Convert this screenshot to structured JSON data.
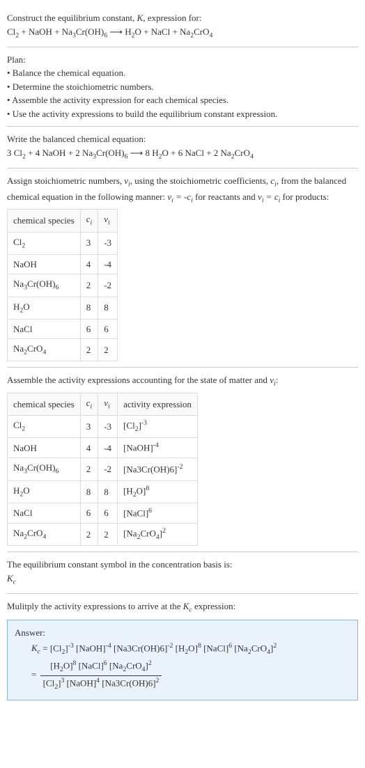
{
  "intro": {
    "line1_a": "Construct the equilibrium constant, ",
    "line1_b": ", expression for:",
    "eq_lhs": "Cl",
    "eq_plus1": " + NaOH + Na",
    "eq_croh": "Cr(OH)",
    "eq_arrow": "  ⟶  H",
    "eq_o_nacl": "O + NaCl + Na",
    "eq_cro4": "CrO"
  },
  "plan": {
    "header": "Plan:",
    "b1": "• Balance the chemical equation.",
    "b2": "• Determine the stoichiometric numbers.",
    "b3": "• Assemble the activity expression for each chemical species.",
    "b4": "• Use the activity expressions to build the equilibrium constant expression."
  },
  "balanced": {
    "header": "Write the balanced chemical equation:",
    "c1": "3 Cl",
    "c2": " + 4 NaOH + 2 Na",
    "c3": "Cr(OH)",
    "c4": "  ⟶  8 H",
    "c5": "O + 6 NaCl + 2 Na",
    "c6": "CrO"
  },
  "assign": {
    "l1a": "Assign stoichiometric numbers, ",
    "l1b": ", using the stoichiometric coefficients, ",
    "l1c": ", from the balanced chemical equation in the following manner: ",
    "l1d": " for reactants and ",
    "l1e": " for products:"
  },
  "table1": {
    "h1": "chemical species",
    "rows": [
      {
        "sp_a": "Cl",
        "sp_sub": "2",
        "sp_b": "",
        "ci": "3",
        "vi": "-3"
      },
      {
        "sp_a": "NaOH",
        "sp_sub": "",
        "sp_b": "",
        "ci": "4",
        "vi": "-4"
      },
      {
        "sp_a": "Na",
        "sp_sub": "3",
        "sp_b": "Cr(OH)",
        "sp_sub2": "6",
        "ci": "2",
        "vi": "-2"
      },
      {
        "sp_a": "H",
        "sp_sub": "2",
        "sp_b": "O",
        "ci": "8",
        "vi": "8"
      },
      {
        "sp_a": "NaCl",
        "sp_sub": "",
        "sp_b": "",
        "ci": "6",
        "vi": "6"
      },
      {
        "sp_a": "Na",
        "sp_sub": "2",
        "sp_b": "CrO",
        "sp_sub2": "4",
        "ci": "2",
        "vi": "2"
      }
    ]
  },
  "assemble": {
    "l1a": "Assemble the activity expressions accounting for the state of matter and ",
    "l1b": ":"
  },
  "table2": {
    "h1": "chemical species",
    "h4": "activity expression",
    "rows": [
      {
        "sp_a": "Cl",
        "sp_sub": "2",
        "sp_b": "",
        "ci": "3",
        "vi": "-3",
        "act_a": "[Cl",
        "act_sub": "2",
        "act_b": "]",
        "act_sup": "-3"
      },
      {
        "sp_a": "NaOH",
        "sp_sub": "",
        "sp_b": "",
        "ci": "4",
        "vi": "-4",
        "act_a": "[NaOH]",
        "act_sub": "",
        "act_b": "",
        "act_sup": "-4"
      },
      {
        "sp_a": "Na",
        "sp_sub": "3",
        "sp_b": "Cr(OH)",
        "sp_sub2": "6",
        "ci": "2",
        "vi": "-2",
        "act_a": "[Na3Cr(OH)6]",
        "act_sub": "",
        "act_b": "",
        "act_sup": "-2"
      },
      {
        "sp_a": "H",
        "sp_sub": "2",
        "sp_b": "O",
        "ci": "8",
        "vi": "8",
        "act_a": "[H",
        "act_sub": "2",
        "act_b": "O]",
        "act_sup": "8"
      },
      {
        "sp_a": "NaCl",
        "sp_sub": "",
        "sp_b": "",
        "ci": "6",
        "vi": "6",
        "act_a": "[NaCl]",
        "act_sub": "",
        "act_b": "",
        "act_sup": "6"
      },
      {
        "sp_a": "Na",
        "sp_sub": "2",
        "sp_b": "CrO",
        "sp_sub2": "4",
        "ci": "2",
        "vi": "2",
        "act_a": "[Na",
        "act_sub": "2",
        "act_b": "CrO",
        "act_sub2": "4",
        "act_c": "]",
        "act_sup": "2"
      }
    ]
  },
  "kc_symbol": {
    "l1": "The equilibrium constant symbol in the concentration basis is:"
  },
  "multiply": {
    "l1a": "Mulitply the activity expressions to arrive at the ",
    "l1b": " expression:"
  },
  "answer": {
    "header": "Answer:",
    "eq_pre": " = [Cl",
    "p1": "]",
    "p2": " [NaOH]",
    "p3": " [Na3Cr(OH)6]",
    "p4": " [H",
    "p5": "O]",
    "p6": " [NaCl]",
    "p7": " [Na",
    "p8": "CrO",
    "p9": "]",
    "num_a": "[H",
    "num_b": "O]",
    "num_c": " [NaCl]",
    "num_d": " [Na",
    "num_e": "CrO",
    "num_f": "]",
    "den_a": "[Cl",
    "den_b": "]",
    "den_c": " [NaOH]",
    "den_d": " [Na3Cr(OH)6]",
    "eq_sign": " = "
  }
}
